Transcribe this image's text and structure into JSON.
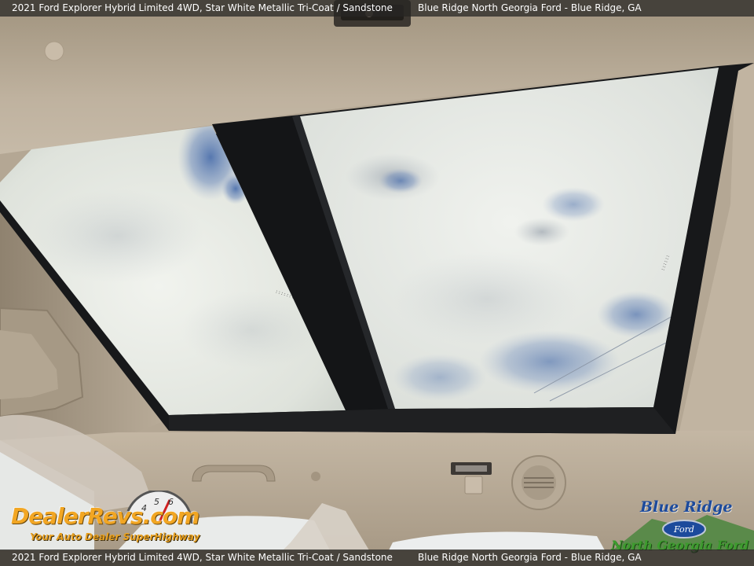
{
  "caption": {
    "vehicle": "2021 Ford Explorer Hybrid Limited 4WD,  Star White Metallic Tri-Coat / Sandstone",
    "dealer": "Blue Ridge North Georgia Ford - Blue Ridge, GA"
  },
  "watermarks": {
    "dealerrevs": {
      "brand": "DealerRevs.com",
      "tagline": "Your Auto Dealer SuperHighway",
      "gauge_digits": [
        "4",
        "5",
        "6"
      ]
    },
    "blueridge": {
      "line1": "Blue Ridge",
      "line2": "North Georgia Ford",
      "badge": "Ford"
    }
  },
  "colors": {
    "headliner": "#b9ab98",
    "sky": "#e4e8e2",
    "sky_blue": "#5f7fb4",
    "frame": "#17181a",
    "dealerrevs_orange": "#f2a623",
    "blueridge_blue": "#1c4a9c",
    "blueridge_green": "#3d9c2e"
  }
}
